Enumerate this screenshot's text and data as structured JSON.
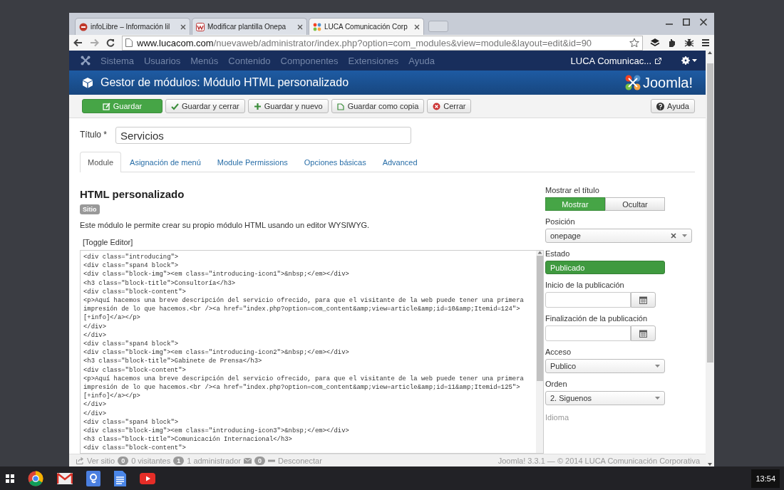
{
  "browser_tabs": [
    {
      "title": "infoLibre – Información lil",
      "kind": "round",
      "selected": false
    },
    {
      "title": "Modificar plantilla Onepa",
      "kind": "square",
      "selected": false
    },
    {
      "title": "LUCA Comunicación Corp",
      "kind": "joomla",
      "selected": true
    }
  ],
  "address_bar": {
    "host": "www.lucacom.com",
    "path": "/nuevaweb/administrator/index.php?option=com_modules&view=module&layout=edit&id=90"
  },
  "admin_menu": {
    "items": [
      "Sistema",
      "Usuarios",
      "Menús",
      "Contenido",
      "Componentes",
      "Extensiones",
      "Ayuda"
    ],
    "user": "LUCA Comunicac..."
  },
  "page_header": {
    "title": "Gestor de módulos: Módulo HTML personalizado",
    "logo": "Joomla!"
  },
  "toolbar": {
    "buttons": [
      {
        "label": "Guardar",
        "kind": "primary"
      },
      {
        "label": "Guardar y cerrar",
        "kind": "default"
      },
      {
        "label": "Guardar y nuevo",
        "kind": "default"
      },
      {
        "label": "Guardar como copia",
        "kind": "default"
      },
      {
        "label": "Cerrar",
        "kind": "default"
      }
    ],
    "help": "Ayuda"
  },
  "title_field": {
    "label": "Título *",
    "value": "Servicios"
  },
  "tabs": [
    {
      "label": "Module",
      "selected": true
    },
    {
      "label": "Asignación de menú",
      "selected": false
    },
    {
      "label": "Module Permissions",
      "selected": false
    },
    {
      "label": "Opciones básicas",
      "selected": false
    },
    {
      "label": "Advanced",
      "selected": false
    }
  ],
  "module": {
    "heading": "HTML personalizado",
    "badge": "Sitio",
    "description": "Este módulo le permite crear su propio módulo HTML usando un editor WYSIWYG.",
    "toggle_editor": "[Toggle Editor]",
    "code_lines": [
      "<div class=\"introducing\">",
      "<div class=\"span4 block\">",
      "<div class=\"block-img\"><em class=\"introducing-icon1\">&nbsp;</em></div>",
      "<h3 class=\"block-title\">Consultoría</h3>",
      "<div class=\"block-content\">",
      "<p>Aquí hacemos una breve descripción del servicio ofrecido, para que el visitante de la web puede tener una primera",
      "impresión de lo que hacemos.<br /><a href=\"index.php?option=com_content&amp;view=article&amp;id=10&amp;Itemid=124\">",
      "[+info]</a></p>",
      "</div>",
      "</div>",
      "<div class=\"span4 block\">",
      "<div class=\"block-img\"><em class=\"introducing-icon2\">&nbsp;</em></div>",
      "<h3 class=\"block-title\">Gabinete de Prensa</h3>",
      "<div class=\"block-content\">",
      "<p>Aquí hacemos una breve descripción del servicio ofrecido, para que el visitante de la web puede tener una primera",
      "impresión de lo que hacemos.<br /><a href=\"index.php?option=com_content&amp;view=article&amp;id=11&amp;Itemid=125\">",
      "[+info]</a></p>",
      "</div>",
      "</div>",
      "<div class=\"span4 block\">",
      "<div class=\"block-img\"><em class=\"introducing-icon3\">&nbsp;</em></div>",
      "<h3 class=\"block-title\">Comunicación Internacional</h3>",
      "<div class=\"block-content\">"
    ]
  },
  "options": [
    {
      "kind": "toggle",
      "label": "Mostrar el título",
      "choices": [
        {
          "label": "Mostrar",
          "selected": true
        },
        {
          "label": "Ocultar",
          "selected": false
        }
      ]
    },
    {
      "kind": "chooser",
      "label": "Posición",
      "value": "onepage"
    },
    {
      "kind": "status",
      "label": "Estado",
      "value": "Publicado"
    },
    {
      "kind": "date",
      "label": "Inicio de la publicación"
    },
    {
      "kind": "date",
      "label": "Finalización de la publicación"
    },
    {
      "kind": "select",
      "label": "Acceso",
      "value": "Publico"
    },
    {
      "kind": "select",
      "label": "Orden",
      "value": "2. Siguenos"
    },
    {
      "kind": "heading",
      "label": "Idioma"
    }
  ],
  "status_bar": {
    "view_site": "Ver sitio",
    "visitors_count": "0",
    "visitors": "0 visitantes",
    "admins_count": "1",
    "admins": "1 administrador",
    "messages_count": "0",
    "logout": "Desconectar",
    "footer": "Joomla! 3.3.1 — © 2014 LUCA Comunicación Corporativa"
  },
  "taskbar": {
    "clock": "13:54"
  }
}
